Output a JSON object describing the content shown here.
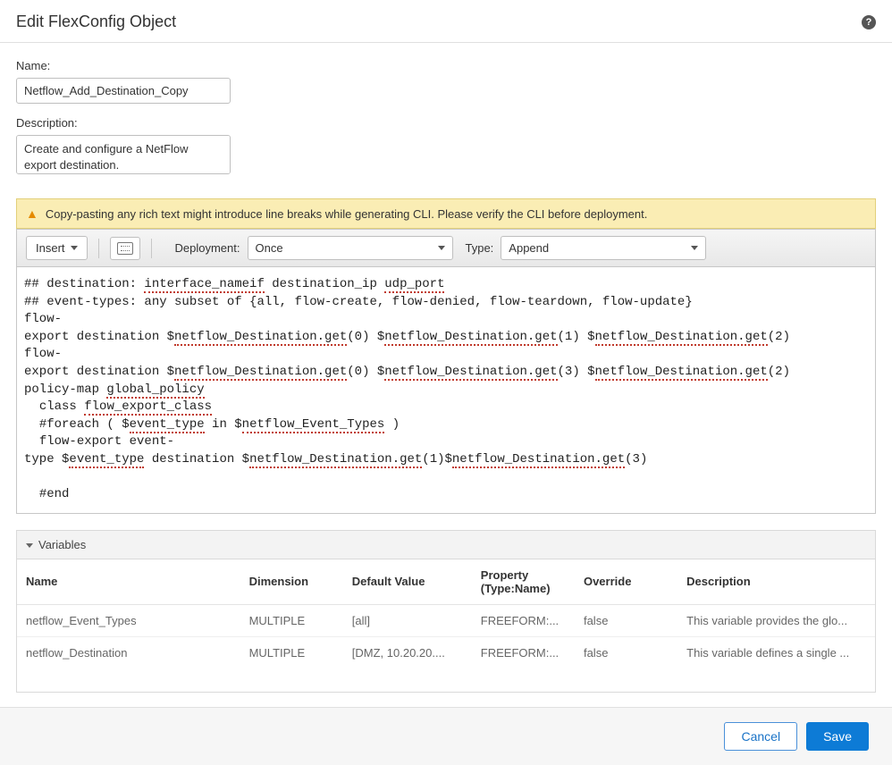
{
  "header": {
    "title": "Edit FlexConfig Object",
    "help_glyph": "?"
  },
  "form": {
    "name_label": "Name:",
    "name_value": "Netflow_Add_Destination_Copy",
    "description_label": "Description:",
    "description_value": "Create and configure a NetFlow export destination."
  },
  "warning": {
    "text": "Copy-pasting any rich text might introduce line breaks while generating CLI. Please verify the CLI before deployment."
  },
  "toolbar": {
    "insert_label": "Insert",
    "deployment_label": "Deployment:",
    "deployment_value": "Once",
    "type_label": "Type:",
    "type_value": "Append"
  },
  "code": {
    "l1a": "## destination: ",
    "l1b": "interface_nameif",
    "l1c": " destination_ip ",
    "l1d": "udp_port",
    "l2": "## event-types: any subset of {all, flow-create, flow-denied, flow-teardown, flow-update}",
    "l3": "flow-",
    "l4a": "export destination $",
    "l4b": "netflow_Destination.get",
    "l4c": "(0) $",
    "l4d": "netflow_Destination.get",
    "l4e": "(1) $",
    "l4f": "netflow_Destination.get",
    "l4g": "(2)",
    "l5": "flow-",
    "l6a": "export destination $",
    "l6b": "netflow_Destination.get",
    "l6c": "(0) $",
    "l6d": "netflow_Destination.get",
    "l6e": "(3) $",
    "l6f": "netflow_Destination.get",
    "l6g": "(2)",
    "l7a": "policy-map ",
    "l7b": "global_policy",
    "l8a": "  class ",
    "l8b": "flow_export_class",
    "l9a": "  #foreach ( $",
    "l9b": "event_type",
    "l9c": " in $",
    "l9d": "netflow_Event_Types",
    "l9e": " )",
    "l10": "  flow-export event-",
    "l11a": "type $",
    "l11b": "event_type",
    "l11c": " destination $",
    "l11d": "netflow_Destination.get",
    "l11e": "(1)$",
    "l11f": "netflow_Destination.get",
    "l11g": "(3)",
    "l12": "",
    "l13": "  #end"
  },
  "variables": {
    "section_label": "Variables",
    "columns": {
      "name": "Name",
      "dimension": "Dimension",
      "default": "Default Value",
      "property_l1": "Property",
      "property_l2": "(Type:Name)",
      "override": "Override",
      "description": "Description"
    },
    "rows": [
      {
        "name": "netflow_Event_Types",
        "dimension": "MULTIPLE",
        "default": "[all]",
        "property": "FREEFORM:...",
        "override": "false",
        "description": "This variable provides the glo..."
      },
      {
        "name": "netflow_Destination",
        "dimension": "MULTIPLE",
        "default": "[DMZ, 10.20.20....",
        "property": "FREEFORM:...",
        "override": "false",
        "description": "This variable defines a single ..."
      }
    ]
  },
  "footer": {
    "cancel": "Cancel",
    "save": "Save"
  }
}
